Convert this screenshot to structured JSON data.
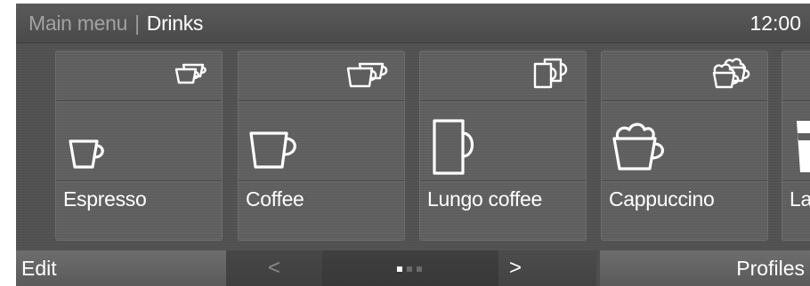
{
  "header": {
    "breadcrumb_parent": "Main menu",
    "separator": "|",
    "breadcrumb_current": "Drinks",
    "clock": "12:00"
  },
  "drinks": [
    {
      "label": "Espresso",
      "icon": "espresso-cup-icon",
      "small_icon": "double-espresso-icon"
    },
    {
      "label": "Coffee",
      "icon": "coffee-cup-icon",
      "small_icon": "double-coffee-icon"
    },
    {
      "label": "Lungo coffee",
      "icon": "lungo-mug-icon",
      "small_icon": "double-lungo-icon"
    },
    {
      "label": "Cappuccino",
      "icon": "cappuccino-cup-icon",
      "small_icon": "double-cappuccino-icon"
    },
    {
      "label": "La",
      "icon": "latte-glass-icon"
    }
  ],
  "footer": {
    "edit_label": "Edit",
    "prev_label": "<",
    "next_label": ">",
    "profiles_label": "Profiles",
    "page_indicator": {
      "current": 1,
      "total": 3
    }
  },
  "colors": {
    "background": "#505050",
    "text": "#ffffff",
    "dim_text": "#a2a2a2",
    "active_dot": "#ffffff",
    "inactive_dot": "#6a6a6a"
  }
}
